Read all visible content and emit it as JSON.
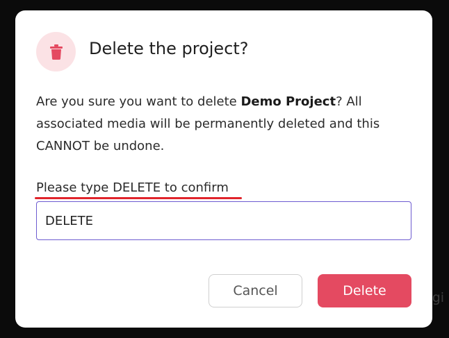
{
  "background": {
    "partial_text": "egi"
  },
  "dialog": {
    "title": "Delete the project?",
    "message_prefix": "Are you sure you want to delete ",
    "project_name": "Demo Project",
    "message_suffix": "? All associated media will be permanently deleted and this CANNOT be undone.",
    "confirm_label": "Please type DELETE to confirm",
    "confirm_input_value": "DELETE",
    "cancel_label": "Cancel",
    "delete_label": "Delete",
    "icon": "trash-icon"
  },
  "colors": {
    "accent_red": "#e44a61",
    "icon_background": "#fbe2e5",
    "input_focus_border": "#6d5bd0",
    "annotation_underline": "#e0242b"
  }
}
